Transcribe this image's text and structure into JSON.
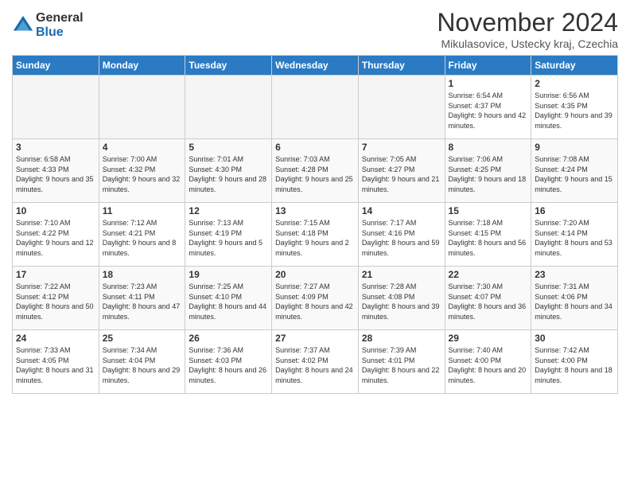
{
  "logo": {
    "general": "General",
    "blue": "Blue"
  },
  "header": {
    "month": "November 2024",
    "location": "Mikulasovice, Ustecky kraj, Czechia"
  },
  "days_of_week": [
    "Sunday",
    "Monday",
    "Tuesday",
    "Wednesday",
    "Thursday",
    "Friday",
    "Saturday"
  ],
  "weeks": [
    [
      {
        "day": "",
        "info": ""
      },
      {
        "day": "",
        "info": ""
      },
      {
        "day": "",
        "info": ""
      },
      {
        "day": "",
        "info": ""
      },
      {
        "day": "",
        "info": ""
      },
      {
        "day": "1",
        "info": "Sunrise: 6:54 AM\nSunset: 4:37 PM\nDaylight: 9 hours and 42 minutes."
      },
      {
        "day": "2",
        "info": "Sunrise: 6:56 AM\nSunset: 4:35 PM\nDaylight: 9 hours and 39 minutes."
      }
    ],
    [
      {
        "day": "3",
        "info": "Sunrise: 6:58 AM\nSunset: 4:33 PM\nDaylight: 9 hours and 35 minutes."
      },
      {
        "day": "4",
        "info": "Sunrise: 7:00 AM\nSunset: 4:32 PM\nDaylight: 9 hours and 32 minutes."
      },
      {
        "day": "5",
        "info": "Sunrise: 7:01 AM\nSunset: 4:30 PM\nDaylight: 9 hours and 28 minutes."
      },
      {
        "day": "6",
        "info": "Sunrise: 7:03 AM\nSunset: 4:28 PM\nDaylight: 9 hours and 25 minutes."
      },
      {
        "day": "7",
        "info": "Sunrise: 7:05 AM\nSunset: 4:27 PM\nDaylight: 9 hours and 21 minutes."
      },
      {
        "day": "8",
        "info": "Sunrise: 7:06 AM\nSunset: 4:25 PM\nDaylight: 9 hours and 18 minutes."
      },
      {
        "day": "9",
        "info": "Sunrise: 7:08 AM\nSunset: 4:24 PM\nDaylight: 9 hours and 15 minutes."
      }
    ],
    [
      {
        "day": "10",
        "info": "Sunrise: 7:10 AM\nSunset: 4:22 PM\nDaylight: 9 hours and 12 minutes."
      },
      {
        "day": "11",
        "info": "Sunrise: 7:12 AM\nSunset: 4:21 PM\nDaylight: 9 hours and 8 minutes."
      },
      {
        "day": "12",
        "info": "Sunrise: 7:13 AM\nSunset: 4:19 PM\nDaylight: 9 hours and 5 minutes."
      },
      {
        "day": "13",
        "info": "Sunrise: 7:15 AM\nSunset: 4:18 PM\nDaylight: 9 hours and 2 minutes."
      },
      {
        "day": "14",
        "info": "Sunrise: 7:17 AM\nSunset: 4:16 PM\nDaylight: 8 hours and 59 minutes."
      },
      {
        "day": "15",
        "info": "Sunrise: 7:18 AM\nSunset: 4:15 PM\nDaylight: 8 hours and 56 minutes."
      },
      {
        "day": "16",
        "info": "Sunrise: 7:20 AM\nSunset: 4:14 PM\nDaylight: 8 hours and 53 minutes."
      }
    ],
    [
      {
        "day": "17",
        "info": "Sunrise: 7:22 AM\nSunset: 4:12 PM\nDaylight: 8 hours and 50 minutes."
      },
      {
        "day": "18",
        "info": "Sunrise: 7:23 AM\nSunset: 4:11 PM\nDaylight: 8 hours and 47 minutes."
      },
      {
        "day": "19",
        "info": "Sunrise: 7:25 AM\nSunset: 4:10 PM\nDaylight: 8 hours and 44 minutes."
      },
      {
        "day": "20",
        "info": "Sunrise: 7:27 AM\nSunset: 4:09 PM\nDaylight: 8 hours and 42 minutes."
      },
      {
        "day": "21",
        "info": "Sunrise: 7:28 AM\nSunset: 4:08 PM\nDaylight: 8 hours and 39 minutes."
      },
      {
        "day": "22",
        "info": "Sunrise: 7:30 AM\nSunset: 4:07 PM\nDaylight: 8 hours and 36 minutes."
      },
      {
        "day": "23",
        "info": "Sunrise: 7:31 AM\nSunset: 4:06 PM\nDaylight: 8 hours and 34 minutes."
      }
    ],
    [
      {
        "day": "24",
        "info": "Sunrise: 7:33 AM\nSunset: 4:05 PM\nDaylight: 8 hours and 31 minutes."
      },
      {
        "day": "25",
        "info": "Sunrise: 7:34 AM\nSunset: 4:04 PM\nDaylight: 8 hours and 29 minutes."
      },
      {
        "day": "26",
        "info": "Sunrise: 7:36 AM\nSunset: 4:03 PM\nDaylight: 8 hours and 26 minutes."
      },
      {
        "day": "27",
        "info": "Sunrise: 7:37 AM\nSunset: 4:02 PM\nDaylight: 8 hours and 24 minutes."
      },
      {
        "day": "28",
        "info": "Sunrise: 7:39 AM\nSunset: 4:01 PM\nDaylight: 8 hours and 22 minutes."
      },
      {
        "day": "29",
        "info": "Sunrise: 7:40 AM\nSunset: 4:00 PM\nDaylight: 8 hours and 20 minutes."
      },
      {
        "day": "30",
        "info": "Sunrise: 7:42 AM\nSunset: 4:00 PM\nDaylight: 8 hours and 18 minutes."
      }
    ]
  ]
}
